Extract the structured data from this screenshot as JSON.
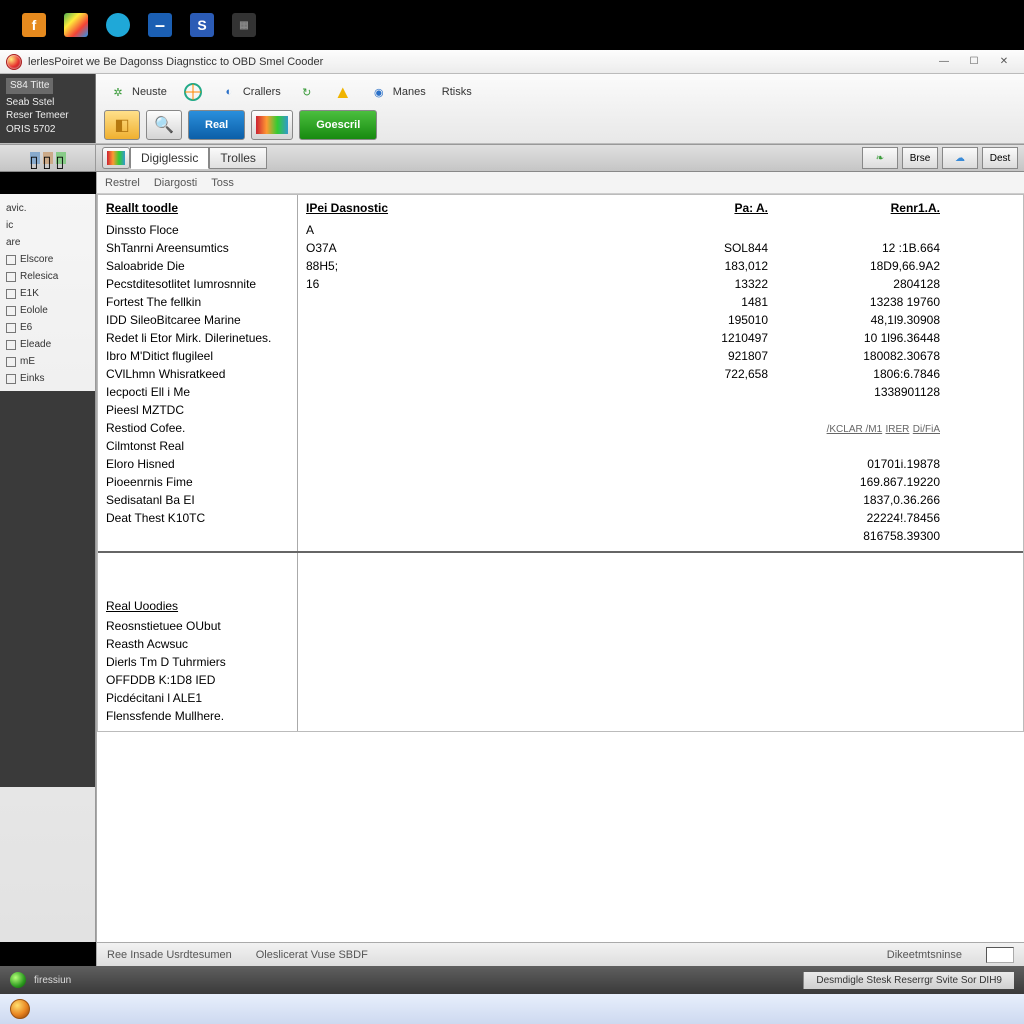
{
  "window": {
    "title": "lerlesPoiret we Be Dagonss Diagnsticc to OBD Smel Cooder"
  },
  "menubar_left": {
    "tab": "S84 Titte",
    "line2": "Seab Sstel",
    "line3": "Reser Temeer",
    "line4": "ORIS 5702"
  },
  "menu_items": [
    "Neuste",
    "",
    "Crallers",
    "",
    "",
    "Manes",
    "Rtisks"
  ],
  "toolbar_buttons": {
    "real": "Real",
    "connect": "Goescril"
  },
  "doc_tabs": [
    "Digiglessic",
    "Trolles"
  ],
  "doc_mini_btns": [
    "",
    "Brse",
    "",
    "Dest"
  ],
  "sub_tabs": [
    "Restrel",
    "Diargosti",
    "Toss"
  ],
  "left_nav": {
    "items": [
      "avic.",
      "ic",
      "are",
      "Elscore",
      "Relesica",
      "E1K",
      "Eolole",
      "E6",
      "Eleade",
      "mE",
      "Einks"
    ]
  },
  "table": {
    "headers": {
      "c1": "Reallt toodle",
      "c2": "IPei Dasnostic",
      "c3": "Pa: A.",
      "c4": "Renr1.A."
    },
    "rows": [
      [
        "Dinssto Floce",
        "A",
        "",
        ""
      ],
      [
        "ShTanrni Areensumtics",
        "O37A",
        "SOL844",
        "12 :1B.664"
      ],
      [
        "Saloabride Die",
        "88H5;",
        "183,012",
        "18D9,66.9A2"
      ],
      [
        "Pecstditesotlitet Iumrosnnite",
        "16",
        "13322",
        "2804128"
      ],
      [
        "Fortest The fellkin",
        "",
        "1481",
        "13238 19760"
      ],
      [
        "IDD SileoBitcaree Marine",
        "",
        "195010",
        "48,1l9.30908"
      ],
      [
        "Redet li Etor Mirk. Dilerinetues.",
        "",
        "1210497",
        "10 1l96.36448"
      ],
      [
        "Ibro M'Ditict flugileel",
        "",
        "921807",
        "180082.30678"
      ],
      [
        "CVlLhmn Whisratkeed",
        "",
        "722,658",
        "1806:6.7846"
      ],
      [
        "Iecpocti Ell i Me",
        "",
        "",
        "1338901128"
      ],
      [
        "Pieesl MZTDC",
        "",
        "",
        ""
      ],
      [
        "Restiod Cofee.",
        "",
        "",
        ""
      ],
      [
        "Cilmtonst Real",
        "",
        "",
        "01701i.19878"
      ],
      [
        "Eloro Hisned",
        "",
        "",
        "169.867.19220"
      ],
      [
        "Pioeenrnis Fime",
        "",
        "",
        "1837,0.36.266"
      ],
      [
        "Sedisatanl Ba EI",
        "",
        "",
        "22224!.78456"
      ],
      [
        "Deat Thest K10TC",
        "",
        "",
        "816758.39300"
      ]
    ],
    "rcol_links": [
      "/KCLAR /M1",
      "IRER",
      "Di/FiA"
    ]
  },
  "lower": {
    "header": "Real Uoodies",
    "items": [
      "Reosnstietuee OUbut",
      "Reasth Acwsuc",
      "Dierls Tm D Tuhrmiers",
      "OFFDDB K:1D8 IED",
      "Picdécitani l ALE1",
      "Flenssfende Mullhere."
    ]
  },
  "statusbar": {
    "left1": "Ree Insade Usrdtesumen",
    "left2": "Oleslicerat Vuse     SBDF",
    "right": "Dikeetmtsninse"
  },
  "os_taskbar": {
    "label": "firessiun",
    "tray": "Desmdigle Stesk Reserrgr Svite Sor DIH9"
  }
}
